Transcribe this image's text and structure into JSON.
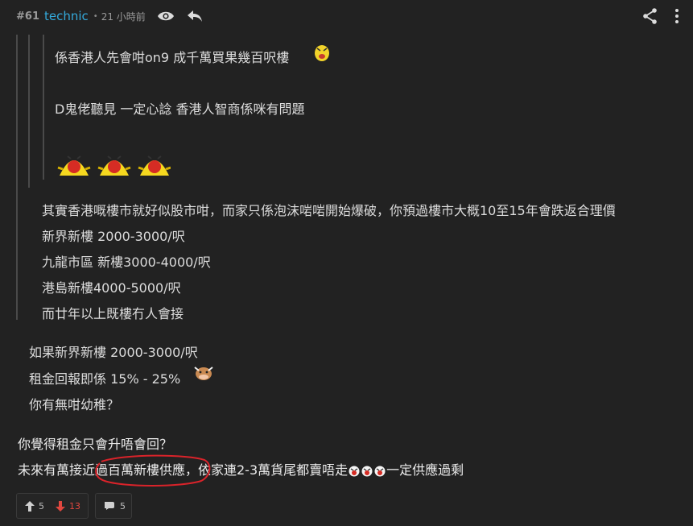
{
  "header": {
    "post_number": "#61",
    "username": "technic",
    "separator": "•",
    "time": "21 小時前",
    "icons": [
      "eye-icon",
      "reply-icon",
      "share-icon",
      "more-vertical-icon"
    ],
    "accent_color": "#34aadc"
  },
  "quote_level3": {
    "line1": "係香港人先會咁on9 成千萬買果幾百呎樓",
    "line2": "D鬼佬聽見 一定心諗 香港人智商係咪有問題",
    "emoji": "yellow-chick-sticker"
  },
  "quote_level2": {
    "lines": [
      "其實香港嘅樓市就好似股市咁，而家只係泡沫啱啱開始爆破，你預過樓市大概10至15年會跌返合理價",
      "新界新樓 2000-3000/呎",
      "九龍市區 新樓3000-4000/呎",
      "港島新樓4000-5000/呎",
      "而廿年以上既樓冇人會接"
    ]
  },
  "quote_level1": {
    "lines": [
      "如果新界新樓 2000-3000/呎",
      "租金回報即係 15% - 25%",
      "你有無咁幼稚？"
    ]
  },
  "reply": {
    "line1": "你覺得租金只會升唔會回？",
    "line2_part1": "未來有萬接近過百萬新樓供應，依家連2-3萬貨尾都賣唔走",
    "line2_part2": "一定供應過剩",
    "annotation_color": "#d9232a"
  },
  "footer": {
    "upvotes": "5",
    "downvotes": "13",
    "replies": "5",
    "up_color": "#d0d0d0",
    "down_color": "#e0473f"
  }
}
